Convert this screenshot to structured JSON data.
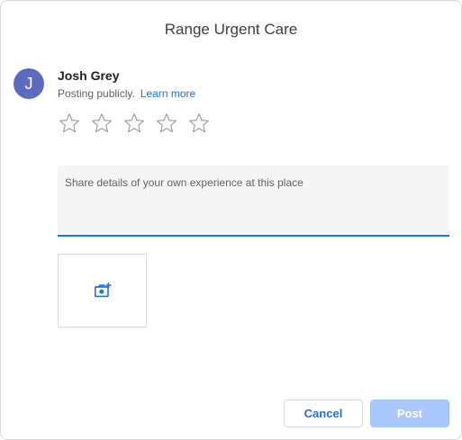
{
  "dialog": {
    "title": "Range Urgent Care"
  },
  "user": {
    "avatar_letter": "J",
    "name": "Josh Grey",
    "posting_text": "Posting publicly.",
    "learn_more_label": "Learn more"
  },
  "rating": {
    "max_stars": 5,
    "selected": 0,
    "star_icon": "star-outline-icon"
  },
  "review": {
    "placeholder": "Share details of your own experience at this place",
    "value": ""
  },
  "photo": {
    "icon": "add-photo-icon"
  },
  "actions": {
    "cancel_label": "Cancel",
    "post_label": "Post"
  },
  "colors": {
    "accent": "#1a73e8",
    "avatar_bg": "#5c6bc0",
    "post_disabled_bg": "#a8c7fa"
  }
}
